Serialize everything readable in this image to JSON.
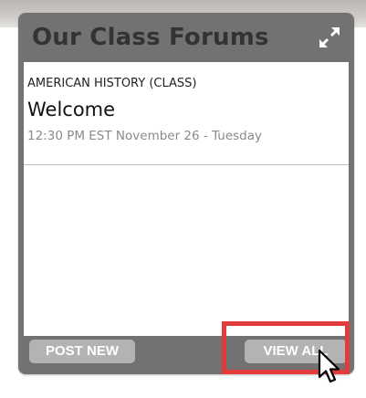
{
  "widget": {
    "title": "Our Class Forums",
    "expand_icon": "expand-arrows-icon"
  },
  "forum_post": {
    "class_name": "AMERICAN HISTORY (CLASS)",
    "topic": "Welcome",
    "timestamp": "12:30 PM EST November 26 - Tuesday"
  },
  "actions": {
    "post_new_label": "POST NEW",
    "view_all_label": "VIEW ALL"
  },
  "colors": {
    "header_bg": "#727272",
    "title_text": "#333333",
    "button_bg": "#b3b3b3",
    "highlight": "#e23b3b",
    "timestamp_text": "#8a8a8a"
  },
  "cursor_icon": "mouse-pointer-icon"
}
